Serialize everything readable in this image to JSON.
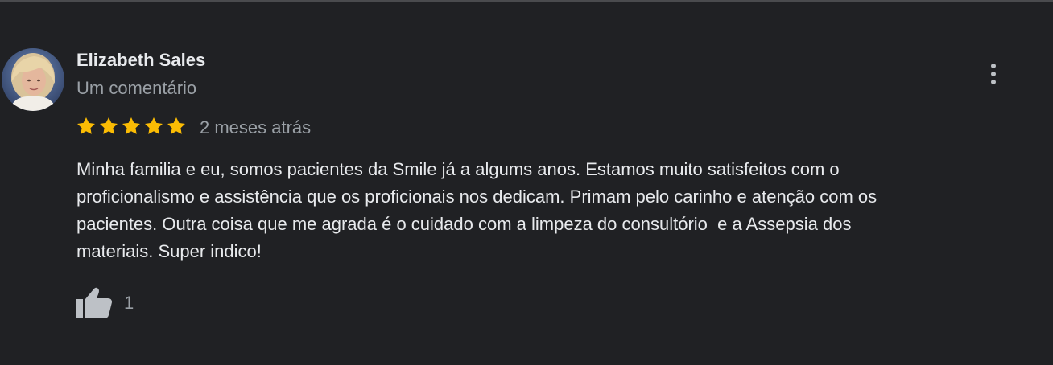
{
  "review": {
    "author_name": "Elizabeth Sales",
    "author_review_count": "Um comentário",
    "rating": 5,
    "rating_max": 5,
    "date": "2 meses atrás",
    "text": "Minha familia e eu, somos pacientes da Smile já a algums anos. Estamos muito satisfeitos com o\nproficionalismo e assistência que os proficionais nos dedicam. Primam pelo carinho e atenção com os\npacientes. Outra coisa que me agrada é o cuidado com a limpeza do consultório  e a Assepsia dos\nmateriais. Super indico!",
    "like_count": "1"
  },
  "icons": {
    "menu": "more-vertical-icon",
    "like": "thumbs-up-icon",
    "star": "star-icon"
  },
  "colors": {
    "background": "#202124",
    "star": "#fbbc04",
    "primary_text": "#e8eaed",
    "secondary_text": "#9aa0a6"
  }
}
